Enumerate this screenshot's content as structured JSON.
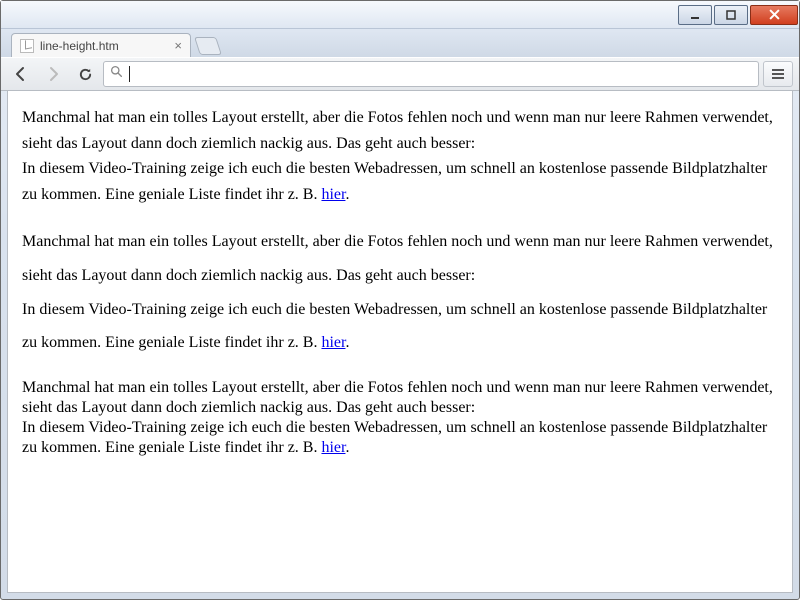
{
  "window": {
    "tab_title": "line-height.htm"
  },
  "toolbar": {
    "url_value": ""
  },
  "content": {
    "paragraphs": [
      {
        "sentences": [
          "Manchmal hat man ein tolles Layout erstellt, aber die Fotos fehlen noch und wenn man nur leere Rahmen verwendet, sieht das Layout dann doch ziemlich nackig aus. Das geht auch besser:",
          "In diesem Video-Training zeige ich euch die besten Webadressen, um schnell an kostenlose passende Bildplatzhalter zu kommen. Eine geniale Liste findet ihr z. B. "
        ],
        "link_text": "hier",
        "after_link": "."
      },
      {
        "sentences": [
          "Manchmal hat man ein tolles Layout erstellt, aber die Fotos fehlen noch und wenn man nur leere Rahmen verwendet, sieht das Layout dann doch ziemlich nackig aus. Das geht auch besser:",
          "In diesem Video-Training zeige ich euch die besten Webadressen, um schnell an kostenlose passende Bildplatzhalter zu kommen. Eine geniale Liste findet ihr z. B. "
        ],
        "link_text": "hier",
        "after_link": "."
      },
      {
        "sentences": [
          "Manchmal hat man ein tolles Layout erstellt, aber die Fotos fehlen noch und wenn man nur leere Rahmen verwendet, sieht das Layout dann doch ziemlich nackig aus. Das geht auch besser:",
          "In diesem Video-Training zeige ich euch die besten Webadressen, um schnell an kostenlose passende Bildplatzhalter zu kommen. Eine geniale Liste findet ihr z. B. "
        ],
        "link_text": "hier",
        "after_link": "."
      }
    ]
  }
}
